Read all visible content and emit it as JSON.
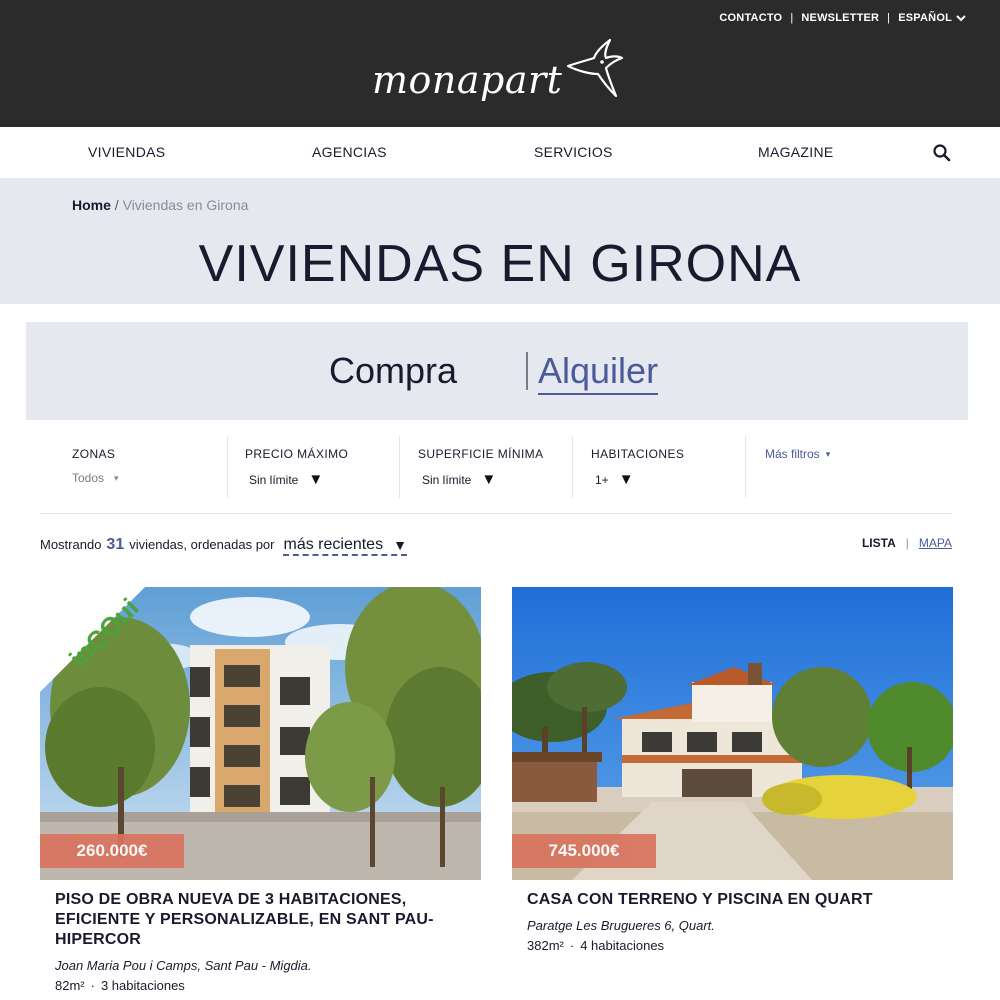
{
  "header": {
    "top_links": [
      "CONTACTO",
      "NEWSLETTER",
      "ESPAÑOL"
    ],
    "separator": "|",
    "logo_text": "monapart"
  },
  "nav": {
    "items": [
      "VIVIENDAS",
      "AGENCIAS",
      "SERVICIOS",
      "MAGAZINE"
    ],
    "search_icon": "search-icon"
  },
  "breadcrumb": {
    "home": "Home",
    "separator": "/",
    "current": "Viviendas en Girona"
  },
  "page_title": "VIVIENDAS EN GIRONA",
  "tabs": {
    "active": "Compra",
    "inactive": "Alquiler"
  },
  "filters": {
    "zonas": {
      "label": "ZONAS",
      "value": "Todos"
    },
    "precio": {
      "label": "PRECIO MÁXIMO",
      "value": "Sin límite"
    },
    "superficie": {
      "label": "SUPERFICIE MÍNIMA",
      "value": "Sin límite"
    },
    "habitaciones": {
      "label": "HABITACIONES",
      "value": "1+"
    },
    "more": "Más filtros"
  },
  "results": {
    "prefix": "Mostrando",
    "count": "31",
    "suffix": "viviendas, ordenadas por",
    "sort": "más recientes",
    "view_list": "LISTA",
    "view_separator": "|",
    "view_map": "MAPA"
  },
  "listings": [
    {
      "price": "260.000€",
      "title": "PISO DE OBRA NUEVA DE 3 HABITACIONES, EFICIENTE Y PERSONALIZABLE, EN SANT PAU-HIPERCOR",
      "address": "Joan Maria Pou i Camps, Sant Pau - Migdia.",
      "area": "82m²",
      "dot": "·",
      "rooms": "3 habitaciones",
      "ribbon": "inCOui"
    },
    {
      "price": "745.000€",
      "title": "CASA CON TERRENO Y PISCINA EN QUART",
      "address": "Paratge Les Brugueres 6, Quart.",
      "area": "382m²",
      "dot": "·",
      "rooms": "4 habitaciones"
    }
  ],
  "colors": {
    "header_bg": "#2b2b2b",
    "band_bg": "#e6e8f0",
    "accent": "#4a5a9a",
    "price_badge": "#d9735e"
  }
}
